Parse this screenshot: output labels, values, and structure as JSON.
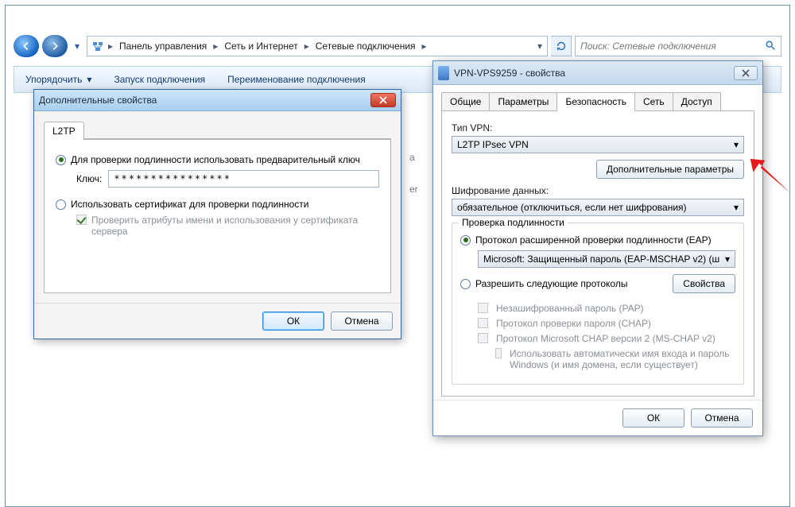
{
  "explorer": {
    "breadcrumb": [
      "Панель управления",
      "Сеть и Интернет",
      "Сетевые подключения"
    ],
    "search_placeholder": "Поиск: Сетевые подключения",
    "toolbar": {
      "organize": "Упорядочить",
      "start": "Запуск подключения",
      "rename": "Переименование подключения"
    }
  },
  "adv_dialog": {
    "title": "Дополнительные свойства",
    "tab": "L2TP",
    "radio_psk": "Для проверки подлинности использовать предварительный ключ",
    "key_label": "Ключ:",
    "key_value": "****************",
    "radio_cert": "Использовать сертификат для проверки подлинности",
    "verify_cert": "Проверить атрибуты имени и использования у сертификата сервера",
    "ok": "ОК",
    "cancel": "Отмена"
  },
  "props_dialog": {
    "title": "VPN-VPS9259 - свойства",
    "tabs": {
      "general": "Общие",
      "options": "Параметры",
      "security": "Безопасность",
      "network": "Сеть",
      "access": "Доступ"
    },
    "vpn_type_label": "Тип VPN:",
    "vpn_type_value": "L2TP IPsec VPN",
    "adv_btn": "Дополнительные параметры",
    "enc_label": "Шифрование данных:",
    "enc_value": "обязательное (отключиться, если нет шифрования)",
    "auth_legend": "Проверка подлинности",
    "radio_eap": "Протокол расширенной проверки подлинности (EAP)",
    "eap_value": "Microsoft: Защищенный пароль (EAP-MSCHAP v2) (ш",
    "radio_allow": "Разрешить следующие протоколы",
    "props_btn": "Свойства",
    "chk_pap": "Незашифрованный пароль (PAP)",
    "chk_chap": "Протокол проверки пароля (CHAP)",
    "chk_mschap": "Протокол Microsoft CHAP версии 2 (MS-CHAP v2)",
    "chk_auto": "Использовать автоматически имя входа и пароль Windows (и имя домена, если существует)",
    "ok": "ОК",
    "cancel": "Отмена"
  },
  "ghost": {
    "a": "а",
    "er": "er"
  }
}
